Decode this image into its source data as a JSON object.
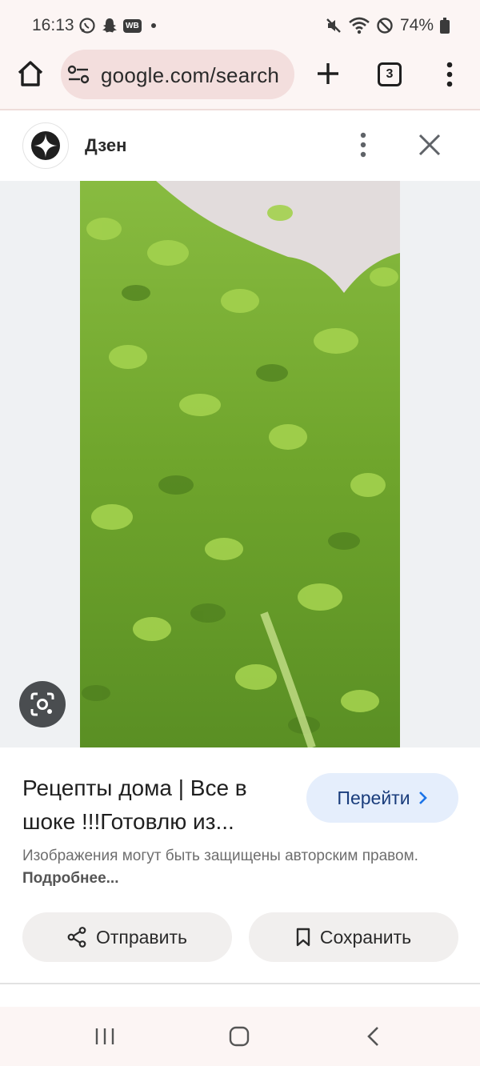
{
  "status_bar": {
    "time": "16:13",
    "left_icons": [
      "whatsapp-icon",
      "snapchat-icon",
      "wb-badge-icon",
      "notification-dot"
    ],
    "wb_badge": "WB",
    "right_icons": [
      "mute-icon",
      "wifi-icon",
      "do-not-disturb-icon",
      "battery-icon"
    ],
    "battery": "74%"
  },
  "browser": {
    "url": "google.com/search",
    "tab_count": "3"
  },
  "source": {
    "name": "Дзен"
  },
  "result": {
    "title": "Рецепты дома | Все в шоке !!!Готовлю из...",
    "visit_label": "Перейти",
    "copyright_text": "Изображения могут быть защищены авторским правом.",
    "more_link": "Подробнее...",
    "share_label": "Отправить",
    "save_label": "Сохранить"
  },
  "colors": {
    "accent": "#1a3d7c",
    "visit_bg": "#e5eefc",
    "chrome_bg": "#fcf5f4"
  }
}
